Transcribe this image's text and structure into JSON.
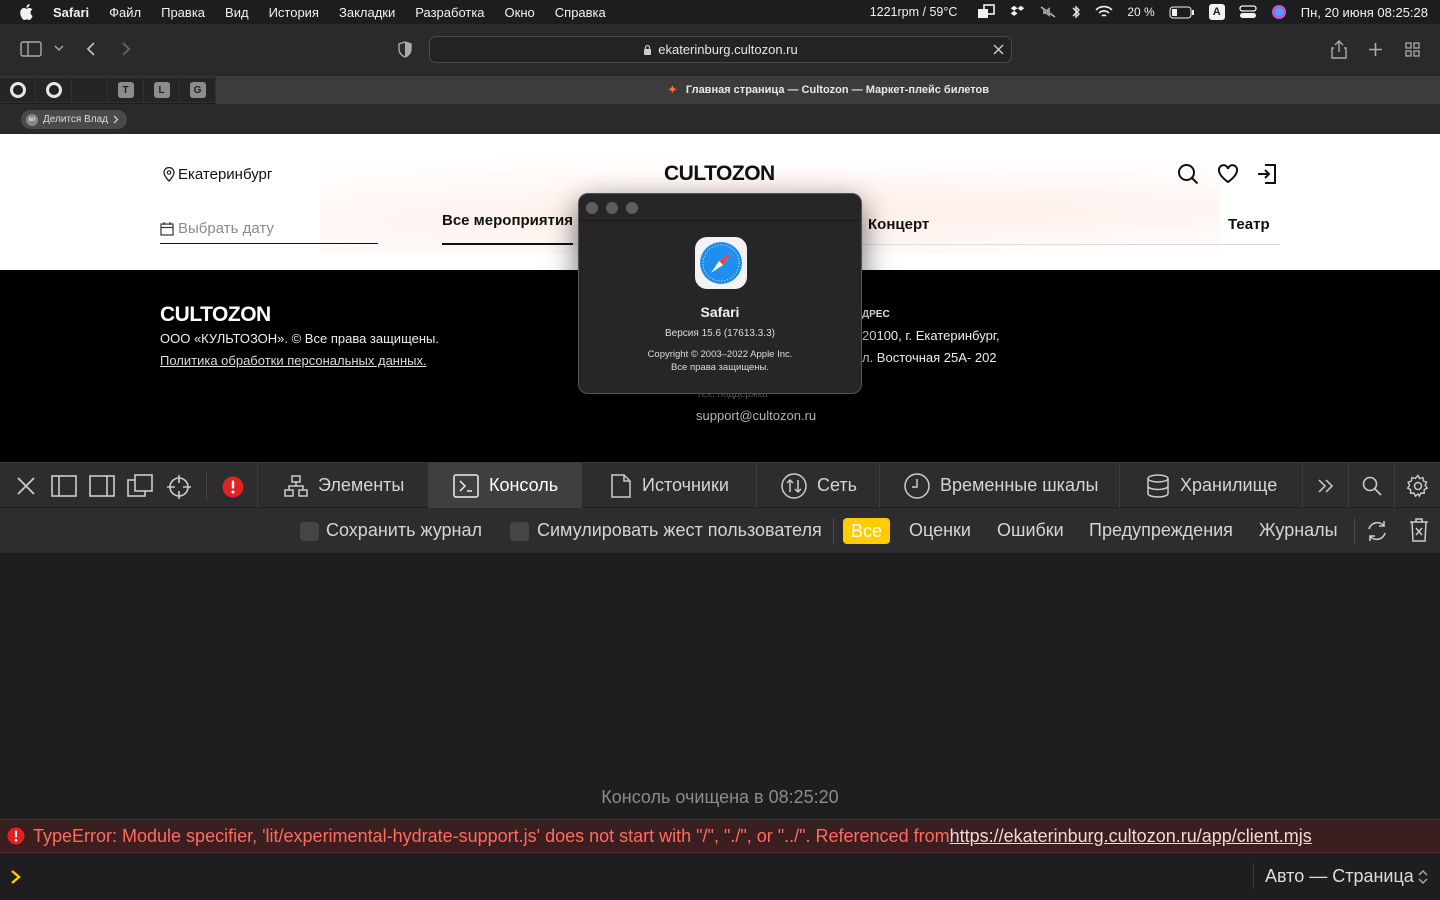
{
  "menubar": {
    "app_name": "Safari",
    "menus": [
      "Файл",
      "Правка",
      "Вид",
      "История",
      "Закладки",
      "Разработка",
      "Окно",
      "Справка"
    ],
    "fan_temp": "1221rpm / 59°C",
    "battery": "20 %",
    "input_source": "A",
    "datetime": "Пн, 20 июня  08:25:28"
  },
  "toolbar": {
    "url": "ekaterinburg.cultozon.ru"
  },
  "tabs": {
    "pinned": [
      "",
      "",
      "",
      "T",
      "L",
      "G"
    ],
    "active_title": "Главная страница — Cultozon — Маркет-плейс билетов",
    "share_chip": "Делится Влад",
    "share_avatar": "вл"
  },
  "site": {
    "city": "Екатеринбург",
    "logo": "CULTOZON",
    "date_placeholder": "Выбрать дату",
    "nav": [
      "Все мероприятия",
      "Концерт",
      "Театр"
    ],
    "footer": {
      "logo": "CULTOZON",
      "copyright": "ООО «КУЛЬТОЗОН». © Все права защищены.",
      "privacy_link": "Политика обработки персональных данных.",
      "address_label": "ДРЕС",
      "address_line1": "20100, г. Екатеринбург,",
      "address_line2": "л. Восточная 25А- 202",
      "support_label": "Тех. поддержка",
      "support_email": "support@cultozon.ru"
    }
  },
  "about_dialog": {
    "app": "Safari",
    "version": "Версия 15.6 (17613.3.3)",
    "copyright": "Copyright © 2003–2022 Apple Inc.",
    "rights": "Все права защищены."
  },
  "devtools": {
    "tabs": [
      "Элементы",
      "Консоль",
      "Источники",
      "Сеть",
      "Временные шкалы",
      "Хранилище"
    ],
    "active_tab": "Консоль",
    "filter": {
      "preserve_log": "Сохранить журнал",
      "simulate_gesture": "Симулировать жест пользователя",
      "levels": [
        "Все",
        "Оценки",
        "Ошибки",
        "Предупреждения",
        "Журналы"
      ],
      "active_level": "Все"
    },
    "console": {
      "cleared": "Консоль очищена в 08:25:20",
      "error_text": "TypeError: Module specifier, 'lit/experimental-hydrate-support.js' does not start with \"/\", \"./\", or \"../\". Referenced from ",
      "error_link": "https://ekaterinburg.cultozon.ru/app/client.mjs",
      "context": "Авто — Страница"
    },
    "colors": {
      "active_level_bg": "#ffcc00",
      "error_text": "#ff6b61",
      "prompt": "#ffcc00"
    }
  }
}
